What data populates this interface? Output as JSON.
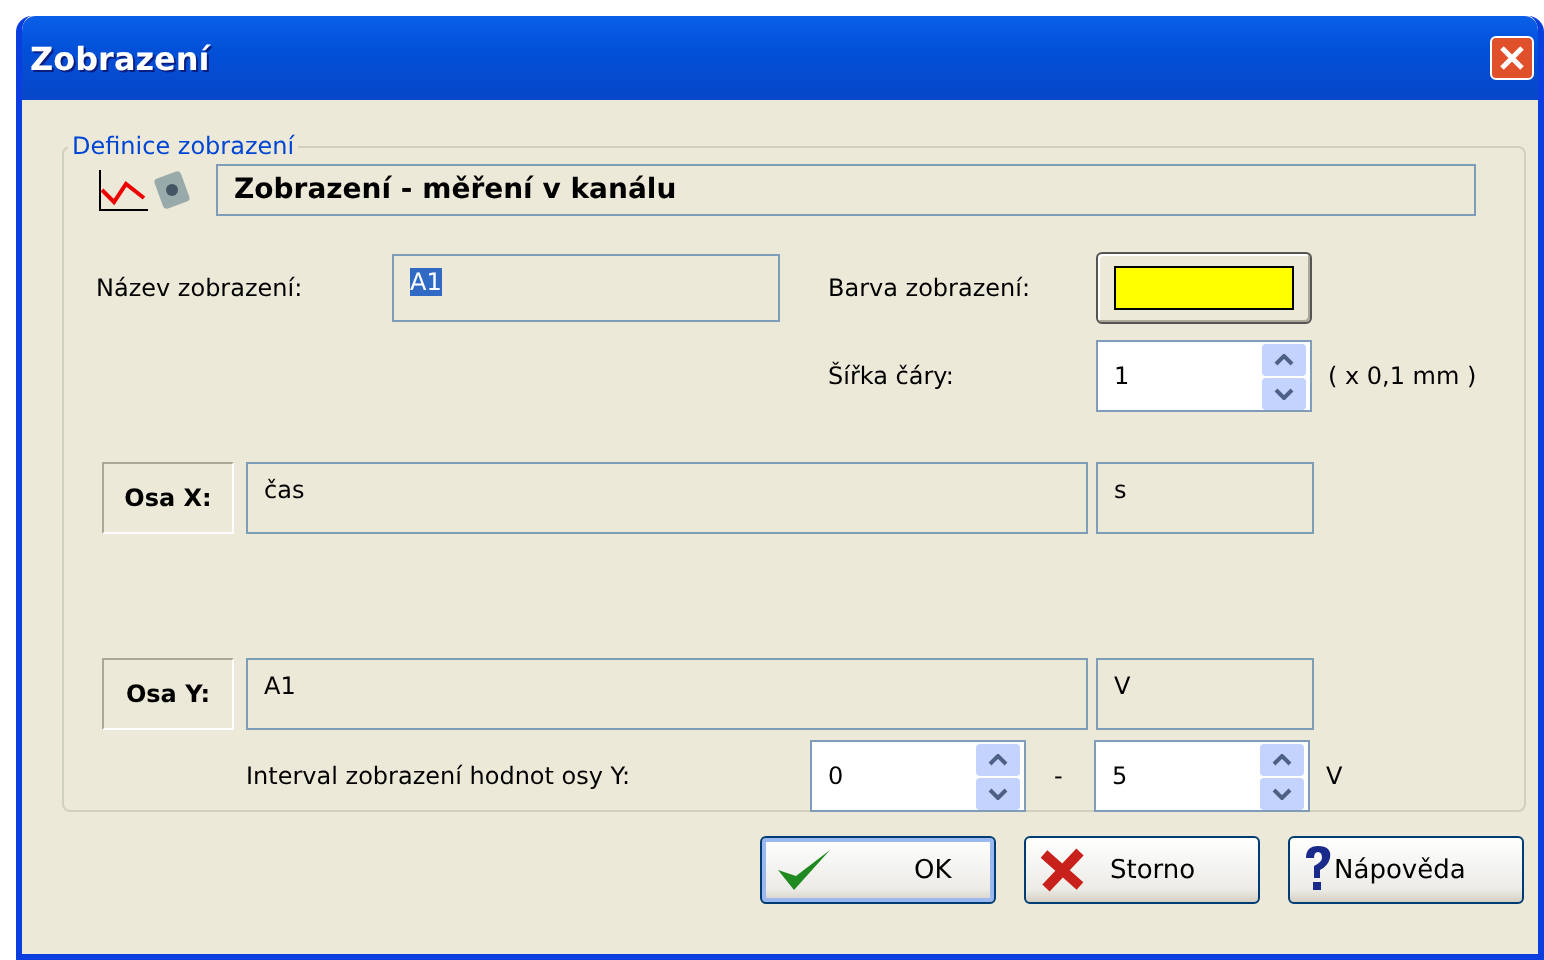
{
  "window": {
    "title": "Zobrazení"
  },
  "group": {
    "title": "Definice zobrazení",
    "header": "Zobrazení - měření v kanálu"
  },
  "name_field": {
    "label": "Název zobrazení:",
    "value": "A1",
    "selected": true
  },
  "color_field": {
    "label": "Barva zobrazení:",
    "color": "#ffff00"
  },
  "line_width": {
    "label": "Šířka čáry:",
    "value": "1",
    "unit": "( x 0,1 mm )"
  },
  "axes": [
    {
      "label": "Osa X:",
      "name": "čas",
      "unit": "s"
    },
    {
      "label": "Osa Y:",
      "name": "A1",
      "unit": "V"
    }
  ],
  "interval": {
    "label": "Interval zobrazení hodnot osy Y:",
    "from": "0",
    "separator": "-",
    "to": "5",
    "unit": "V"
  },
  "buttons": [
    {
      "kind": "ok",
      "label": "OK"
    },
    {
      "kind": "cancel",
      "label": "Storno"
    },
    {
      "kind": "help",
      "label": "Nápověda"
    }
  ]
}
